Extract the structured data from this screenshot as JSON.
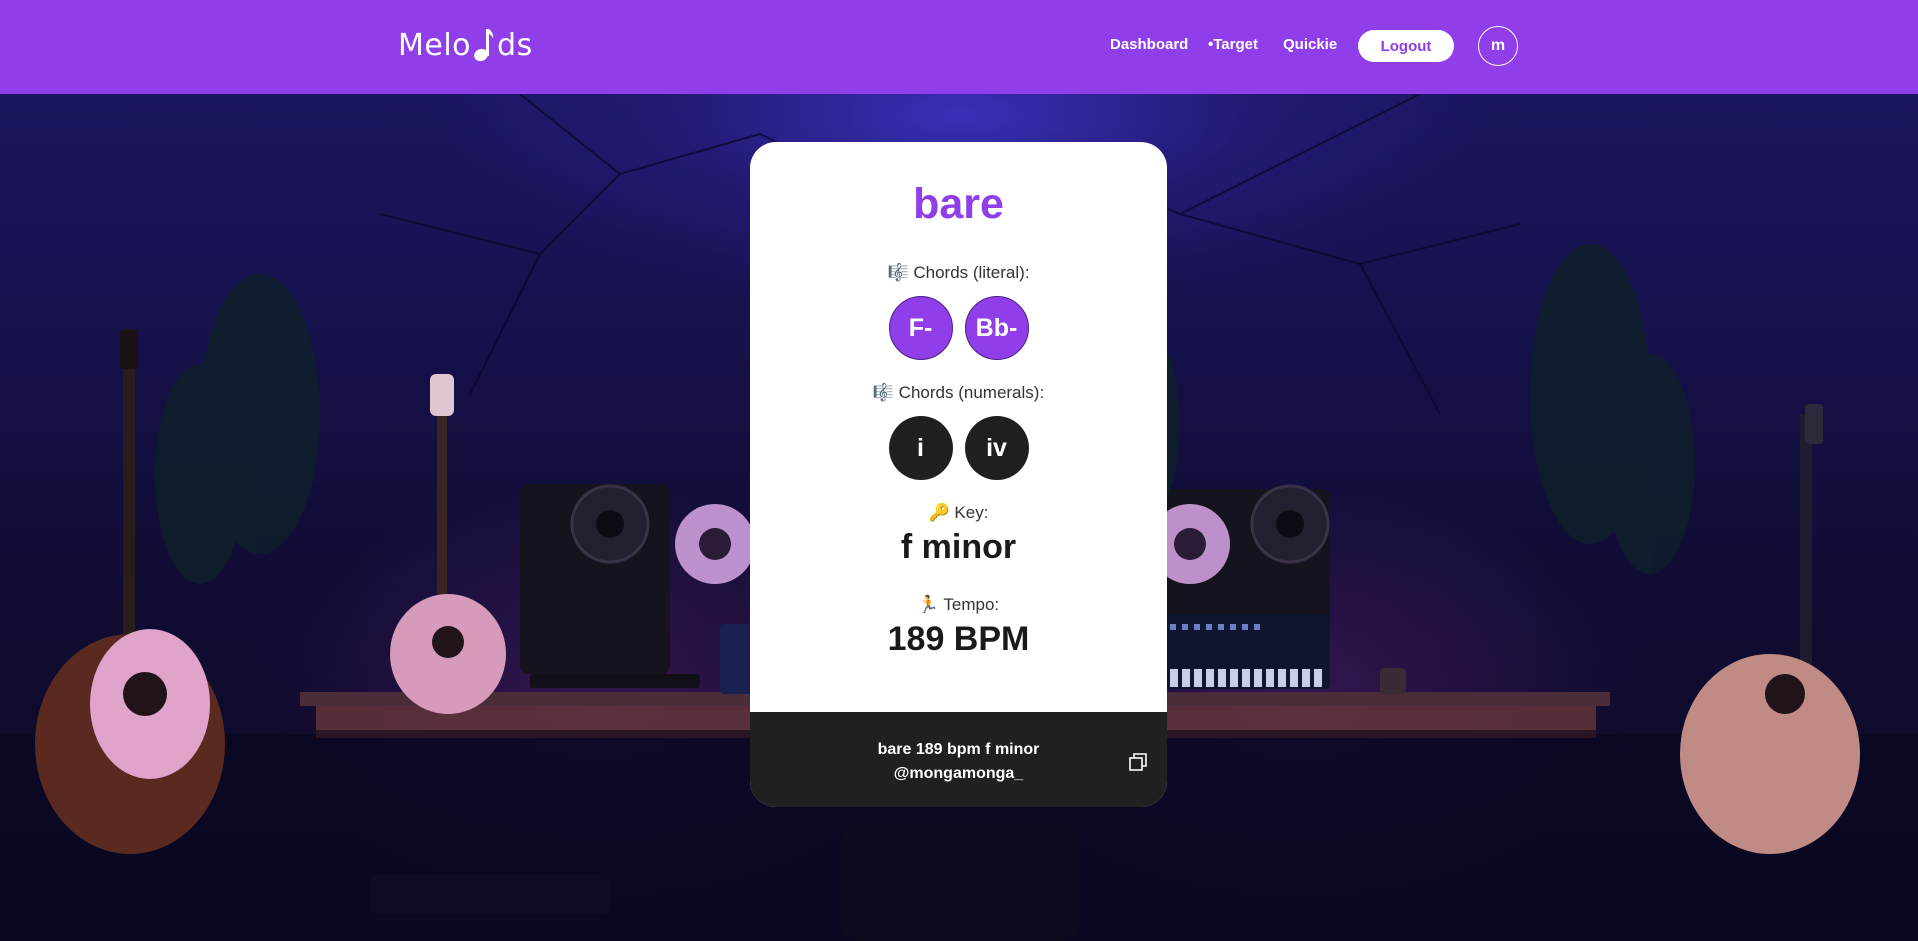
{
  "header": {
    "logo_text_left": "Melo",
    "logo_text_right": "ds",
    "nav": {
      "dashboard": "Dashboard",
      "target": "•Target",
      "quickie": "Quickie"
    },
    "logout_label": "Logout",
    "avatar_initial": "m"
  },
  "song": {
    "title": "bare",
    "chords_literal_label": "🎼 Chords (literal):",
    "chords_literal": [
      "F-",
      "Bb-"
    ],
    "chords_numerals_label": "🎼 Chords (numerals):",
    "chords_numerals": [
      "i",
      "iv"
    ],
    "key_label": "🔑 Key:",
    "key": "f minor",
    "tempo_label": "🏃 Tempo:",
    "tempo": "189 BPM"
  },
  "footer": {
    "line1": "bare 189 bpm f minor",
    "line2": "@mongamonga_"
  },
  "colors": {
    "brand": "#8f3ee9",
    "chip_dark": "#1f1f1f",
    "footer_bg": "#202020"
  },
  "icons": {
    "copy": "copy-icon",
    "logo_note": "music-note-icon"
  }
}
